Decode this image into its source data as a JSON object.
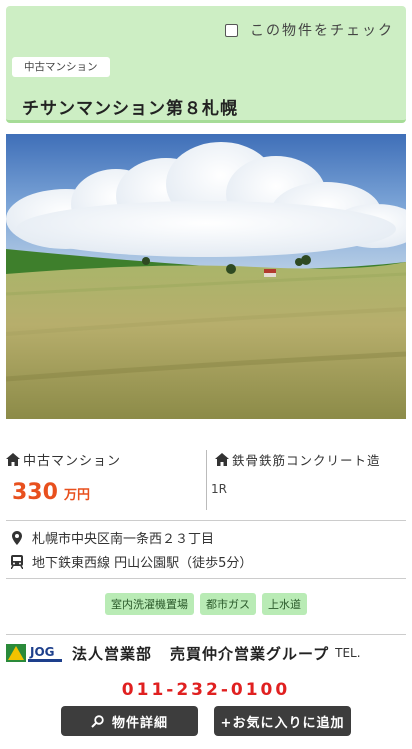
{
  "header": {
    "check_label": "この物件をチェック",
    "type_tag": "中古マンション",
    "property_name": "チサンマンション第８札幌"
  },
  "summary": {
    "type_label": "中古マンション",
    "price_value": "330",
    "price_unit": "万円",
    "structure_label": "鉄骨鉄筋コンクリート造",
    "layout": "1R"
  },
  "location": {
    "address": "札幌市中央区南一条西２３丁目",
    "station": "地下鉄東西線 円山公園駅（徒歩5分）"
  },
  "features": [
    "室内洗濯機置場",
    "都市ガス",
    "上水道"
  ],
  "company": {
    "logo_text": "JOG",
    "department": "法人営業部",
    "group": "売買仲介営業グループ",
    "tel_label": "TEL.",
    "phone": "011-232-0100"
  },
  "buttons": {
    "detail": "物件詳細",
    "favorite": "+お気に入りに追加"
  },
  "colors": {
    "header_bg": "#cdeec4",
    "price": "#e8501e",
    "phone": "#e02020",
    "tag_bg": "#b9ebb5",
    "button_bg": "#3d3d3d"
  },
  "icons": [
    "house-icon",
    "map-pin-icon",
    "train-icon",
    "search-icon"
  ]
}
